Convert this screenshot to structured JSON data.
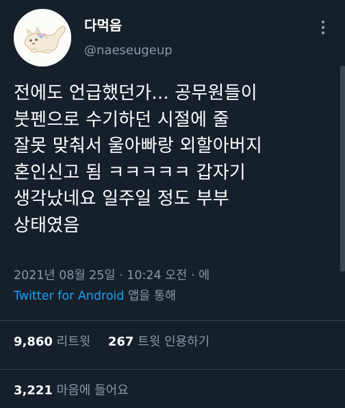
{
  "author": {
    "display_name": "다먹음",
    "handle": "@naeseugeup",
    "avatar": "cream-cat-avatar"
  },
  "icons": {
    "more": "more-vertical-icon"
  },
  "tweet": {
    "text": "전에도 언급했던가... 공무원들이\n붓펜으로 수기하던 시절에 줄\n잘못 맞춰서 울아빠랑 외할아버지\n혼인신고 됨 ㅋㅋㅋㅋㅋ 갑자기\n생각났네요 일주일 정도 부부\n상태였음",
    "timestamp": "2021년 08월 25일 · 10:24 오전 · 에",
    "source_app": "Twitter for Android",
    "source_suffix": "앱을 통해"
  },
  "stats": {
    "retweets_count": "9,860",
    "retweets_label": "리트윗",
    "quotes_count": "267",
    "quotes_label": "트윗 인용하기",
    "likes_count": "3,221",
    "likes_label": "마음에 들어요"
  },
  "colors": {
    "background": "#15202b",
    "text_primary": "#ffffff",
    "text_secondary": "#8899a6",
    "link": "#1da1f2",
    "divider": "#38444d"
  }
}
